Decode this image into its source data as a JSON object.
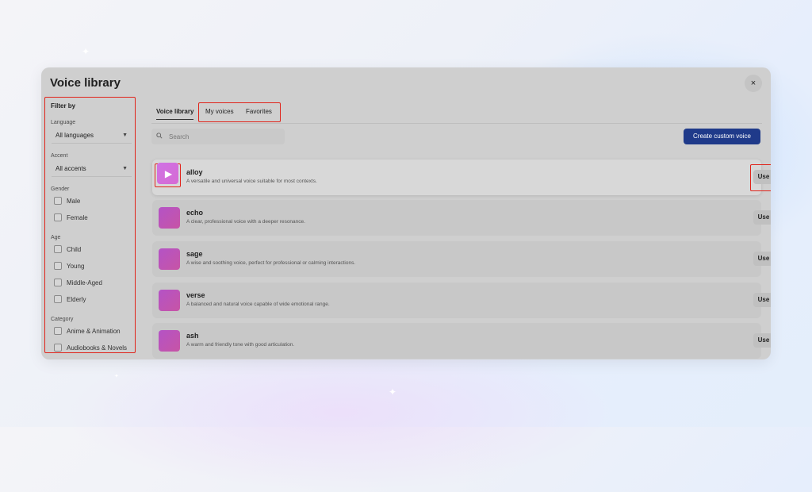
{
  "modal": {
    "title": "Voice library",
    "close_glyph": "×"
  },
  "filters": {
    "title": "Filter by",
    "language": {
      "label": "Language",
      "value": "All languages"
    },
    "accent": {
      "label": "Accent",
      "value": "All accents"
    },
    "gender": {
      "label": "Gender",
      "options": [
        "Male",
        "Female"
      ]
    },
    "age": {
      "label": "Age",
      "options": [
        "Child",
        "Young",
        "Middle-Aged",
        "Elderly"
      ]
    },
    "category": {
      "label": "Category",
      "options": [
        "Anime & Animation",
        "Audiobooks & Novels"
      ]
    }
  },
  "tabs": [
    {
      "label": "Voice library",
      "active": true
    },
    {
      "label": "My voices",
      "active": false
    },
    {
      "label": "Favorites",
      "active": false
    }
  ],
  "search": {
    "placeholder": "Search",
    "value": ""
  },
  "create_button": "Create custom voice",
  "voices": [
    {
      "name": "alloy",
      "description": "A versatile and universal voice suitable for most contexts.",
      "use_label": "Use"
    },
    {
      "name": "echo",
      "description": "A clear, professional voice with a deeper resonance.",
      "use_label": "Use"
    },
    {
      "name": "sage",
      "description": "A wise and soothing voice, perfect for professional or calming interactions.",
      "use_label": "Use"
    },
    {
      "name": "verse",
      "description": "A balanced and natural voice capable of wide emotional range.",
      "use_label": "Use"
    },
    {
      "name": "ash",
      "description": "A warm and friendly tone with good articulation.",
      "use_label": "Use"
    }
  ],
  "icons": {
    "search": "search-icon",
    "chevron": "chevron-down-icon",
    "star": "star-icon",
    "play": "play-icon",
    "close": "close-icon"
  },
  "colors": {
    "accent": "#1f3a8a",
    "highlight": "#e0241b",
    "thumb": "#b453c6"
  }
}
